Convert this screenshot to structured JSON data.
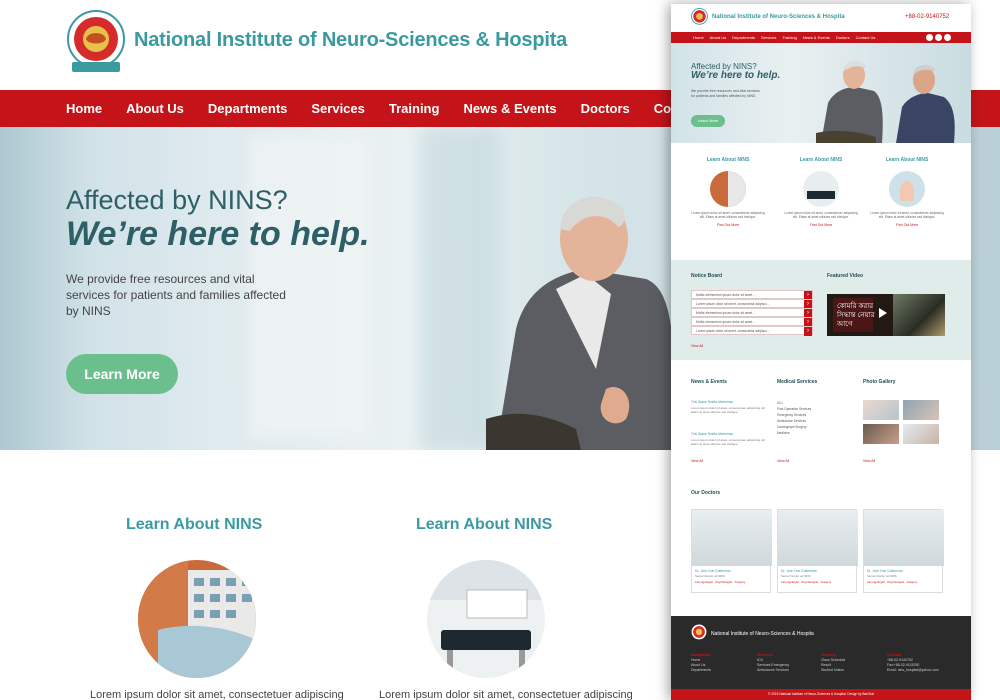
{
  "site": {
    "title": "National Institute of Neuro-Sciences & Hospita",
    "phone": "+88-02-9140752"
  },
  "nav": {
    "items": [
      "Home",
      "About Us",
      "Departments",
      "Services",
      "Training",
      "News & Events",
      "Doctors",
      "Conta"
    ]
  },
  "hero": {
    "line1": "Affected by NINS?",
    "line2": "We’re here to help.",
    "text": "We provide free resources and vital services for patients and families affected by NINS",
    "button": "Learn More"
  },
  "learn": {
    "heading": "Learn About NINS",
    "lorem": "Lorem ipsum dolor sit amet, consectetuer adipiscing"
  },
  "mock": {
    "title": "National Institute of Neuro-Sciences & Hospita",
    "phone": "+88-02-9140752",
    "nav": [
      "Home",
      "About Us",
      "Departments",
      "Services",
      "Training",
      "News & Events",
      "Doctors",
      "Contact Us"
    ],
    "hero_line1": "Affected by NINS?",
    "hero_line2": "We’re here to help.",
    "hero_text": "We provide free resources and vital services for patients and families affected by NINS",
    "hero_button": "Learn More",
    "learn_heading": "Learn About NINS",
    "learn_text": "Lorem ipsum dolor sit amet, consectetuer adipiscing elit. Etiam at amet ultricies sed tristique.",
    "find_out_more": "Find Out More",
    "notice_title": "Notice Board",
    "notice_items": [
      "Mollis elementum ipsum dolor sit amet...",
      "Lorem ipsum dolor sit amet, consectetur adipisci...",
      "Mollis elementum ipsum dolor sit amet...",
      "Mollis elementum ipsum dolor sit amet...",
      "Lorem ipsum dolor sit amet, consectetur adipisci..."
    ],
    "view_all": "View All",
    "video_title": "Featured Video",
    "video_text1": "কোমরি করার",
    "video_text2": "সিদ্ধান্ত নেয়ার",
    "video_text3": "আগে",
    "news_title": "News & Events",
    "news_items": [
      "This Space Nobilis Maecenas",
      "This Space Nobilis Maecenas"
    ],
    "news_text": "Lorem ipsum dolor sit amet, consectetuer adipiscing elit. Etiam at amet ultricies sed tristique.",
    "medical_title": "Medical Services",
    "medical_items": [
      "ICU",
      "Post Operative Services",
      "Emergency Services",
      "Ambulance Services",
      "Cardiograph Surgery",
      "Medicine"
    ],
    "gallery_title": "Photo Gallery",
    "view": "View All",
    "doctors_title": "Our Doctors",
    "doctors": [
      {
        "name": "Dr. John Doe Gutterman",
        "dept": "Senior Doctor at NINS",
        "spec": "Laryngologist . Psychologist . Surgery"
      },
      {
        "name": "Dr. John Doe Gutterman",
        "dept": "Senior Doctor at NINS",
        "spec": "Laryngologist . Psychologist . Surgery"
      },
      {
        "name": "Dr. John Doe Gutterman",
        "dept": "Senior Doctor at NINS",
        "spec": "Laryngologist . Psychologist . Surgery"
      }
    ],
    "footer_title": "National Institute of Neuro-Sciences & Hospita",
    "footer_cols": [
      {
        "head": "Navigation",
        "items": [
          "Home",
          "About Us",
          "Departments"
        ]
      },
      {
        "head": "Services",
        "items": [
          "ICU",
          "Services Emergency",
          "Ambulance Services"
        ]
      },
      {
        "head": "Training",
        "items": [
          "Class Schedule",
          "Result",
          "Student Notice"
        ]
      },
      {
        "head": "Contact",
        "items": [
          "+88-02-9140752",
          "Fax:+88-02-9115250",
          "Email: nins_hospital@yahoo.com"
        ]
      }
    ],
    "copyright": "© 2015 National Institute of Neuro-Sciences & Hospital. Design by BanGlat"
  },
  "colors": {
    "brand_red": "#c4141a",
    "teal": "#3a9aa0",
    "green_button": "#6bbf8c"
  }
}
